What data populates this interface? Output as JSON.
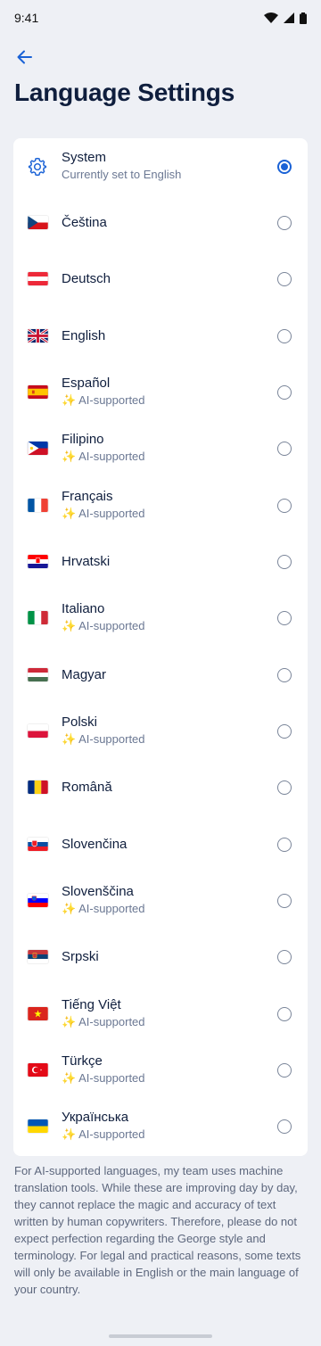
{
  "status": {
    "time": "9:41"
  },
  "title": "Language Settings",
  "languages": [
    {
      "label": "System",
      "subtitle": "Currently set to English",
      "icon": "gear-icon",
      "selected": true
    },
    {
      "label": "Čeština",
      "subtitle": "",
      "icon": "flag-czech",
      "selected": false
    },
    {
      "label": "Deutsch",
      "subtitle": "",
      "icon": "flag-austria",
      "selected": false
    },
    {
      "label": "English",
      "subtitle": "",
      "icon": "flag-uk",
      "selected": false
    },
    {
      "label": "Español",
      "subtitle": "✨ AI-supported",
      "icon": "flag-spain",
      "selected": false
    },
    {
      "label": "Filipino",
      "subtitle": "✨ AI-supported",
      "icon": "flag-philippines",
      "selected": false
    },
    {
      "label": "Français",
      "subtitle": "✨ AI-supported",
      "icon": "flag-france",
      "selected": false
    },
    {
      "label": "Hrvatski",
      "subtitle": "",
      "icon": "flag-croatia",
      "selected": false
    },
    {
      "label": "Italiano",
      "subtitle": "✨ AI-supported",
      "icon": "flag-italy",
      "selected": false
    },
    {
      "label": "Magyar",
      "subtitle": "",
      "icon": "flag-hungary",
      "selected": false
    },
    {
      "label": "Polski",
      "subtitle": "✨ AI-supported",
      "icon": "flag-poland",
      "selected": false
    },
    {
      "label": "Română",
      "subtitle": "",
      "icon": "flag-romania",
      "selected": false
    },
    {
      "label": "Slovenčina",
      "subtitle": "",
      "icon": "flag-slovakia",
      "selected": false
    },
    {
      "label": "Slovenščina",
      "subtitle": "✨ AI-supported",
      "icon": "flag-slovenia",
      "selected": false
    },
    {
      "label": "Srpski",
      "subtitle": "",
      "icon": "flag-serbia",
      "selected": false
    },
    {
      "label": "Tiếng Việt",
      "subtitle": "✨ AI-supported",
      "icon": "flag-vietnam",
      "selected": false
    },
    {
      "label": "Türkçe",
      "subtitle": "✨ AI-supported",
      "icon": "flag-turkey",
      "selected": false
    },
    {
      "label": "Українська",
      "subtitle": "✨ AI-supported",
      "icon": "flag-ukraine",
      "selected": false
    }
  ],
  "footer_note": "For AI-supported languages, my team uses machine translation tools. While these are improving day by day, they cannot replace the magic and accuracy of text written by human copywriters. Therefore, please do not expect perfection regarding the George style and terminology. For legal and practical reasons, some texts will only be available in English or the main language of your country.",
  "colors": {
    "accent": "#1a62d6",
    "title": "#0f1e3d",
    "background": "#eef0f5"
  }
}
